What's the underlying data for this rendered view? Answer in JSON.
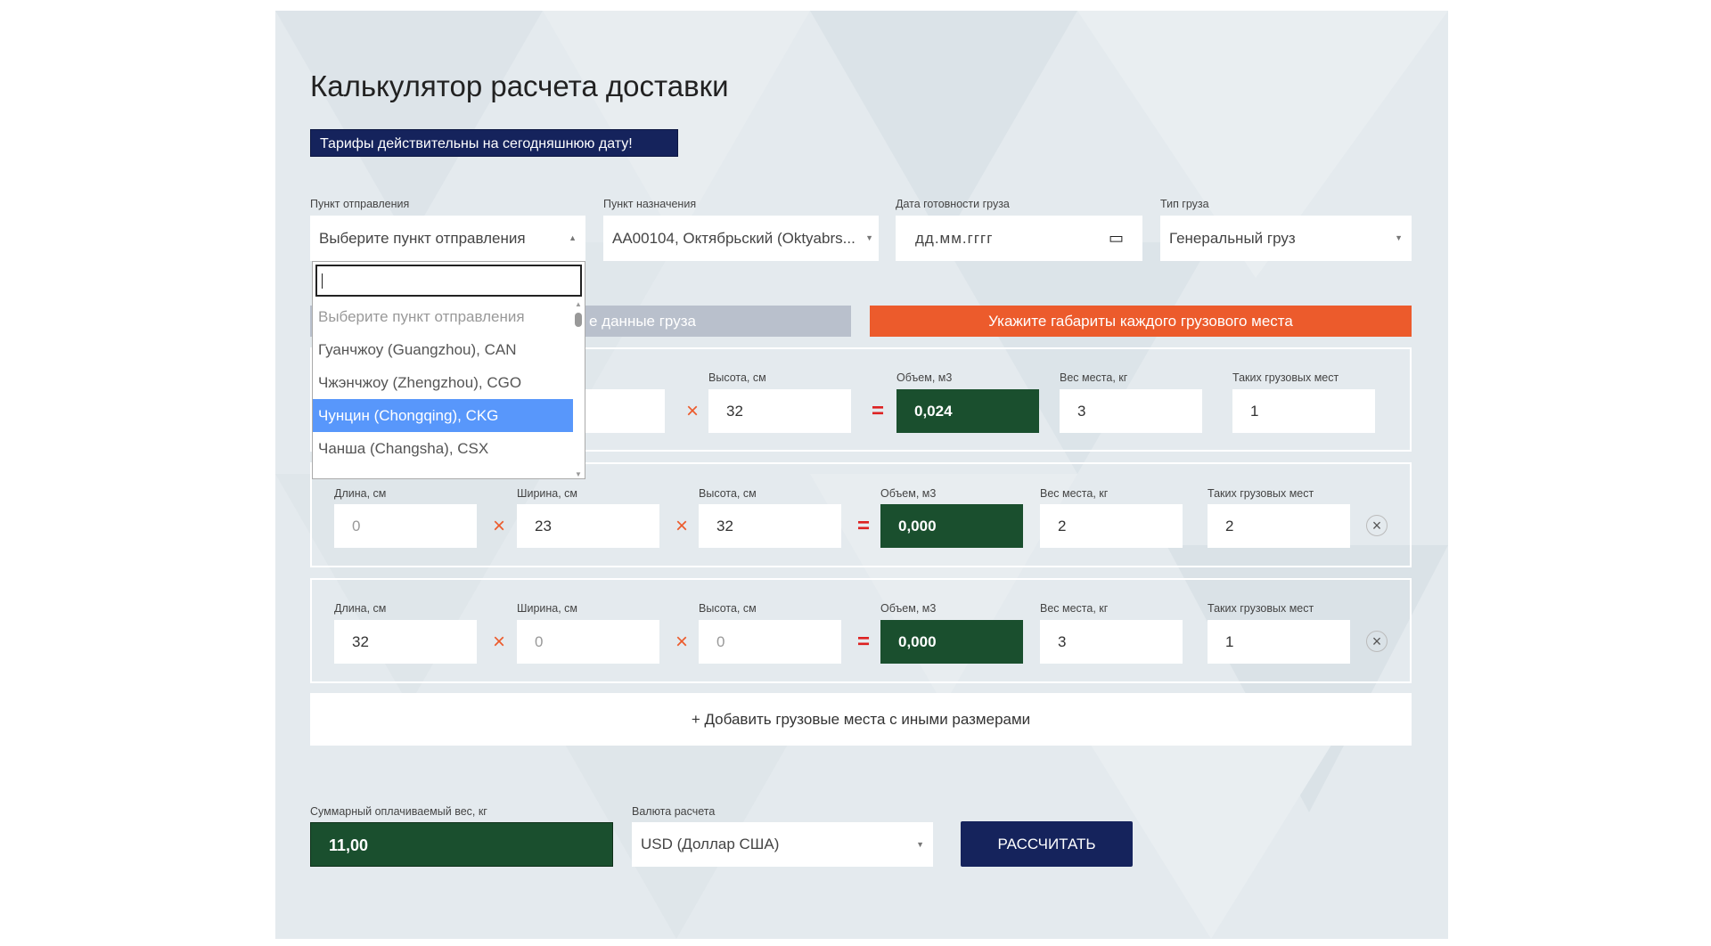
{
  "title": "Калькулятор расчета доставки",
  "banner": "Тарифы действительны на сегодняшнюю дату!",
  "filters": {
    "origin": {
      "label": "Пункт отправления",
      "value": "Выберите пункт отправления"
    },
    "destination": {
      "label": "Пункт назначения",
      "value": "AA00104, Октябрьский (Oktyabrs..."
    },
    "date": {
      "label": "Дата готовности груза",
      "placeholder": "дд.мм.гггг"
    },
    "cargo_type": {
      "label": "Тип груза",
      "value": "Генеральный груз"
    }
  },
  "tabs": {
    "general_partial": "е данные груза",
    "dimensions": "Укажите габариты каждого грузового места"
  },
  "labels": {
    "length": "Длина, см",
    "width": "Ширина, см",
    "height": "Высота, см",
    "volume": "Объем, м3",
    "weight": "Вес места, кг",
    "qty": "Таких грузовых мест"
  },
  "rows": [
    {
      "length": "",
      "width": "",
      "height": "32",
      "volume": "0,024",
      "weight": "3",
      "qty": "1"
    },
    {
      "length": "0",
      "width": "23",
      "height": "32",
      "volume": "0,000",
      "weight": "2",
      "qty": "2"
    },
    {
      "length": "32",
      "width": "0",
      "height": "0",
      "volume": "0,000",
      "weight": "3",
      "qty": "1"
    }
  ],
  "add_button": "+ Добавить грузовые места с иными размерами",
  "total": {
    "label": "Суммарный оплачиваемый вес, кг",
    "value": "11,00"
  },
  "currency": {
    "label": "Валюта расчета",
    "value": "USD (Доллар США)"
  },
  "calculate_button": "РАССЧИТАТЬ",
  "dropdown": {
    "search_value": "",
    "options": [
      "Выберите пункт отправления",
      "Гуанчжоу (Guangzhou), CAN",
      "Чжэнчжоу (Zhengzhou), CGO",
      "Чунцин (Chongqing), CKG",
      "Чанша (Changsha), CSX"
    ],
    "highlighted": "Чунцин (Chongqing), CKG"
  },
  "colors": {
    "navy": "#15235c",
    "green": "#1a4f2e",
    "orange": "#ec5b2c",
    "highlight": "#5897fb"
  }
}
